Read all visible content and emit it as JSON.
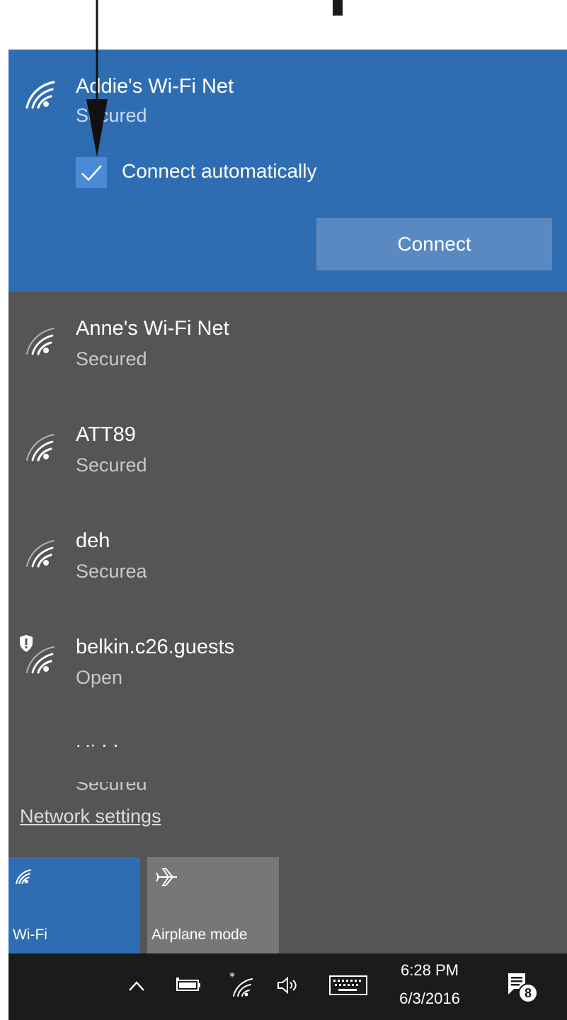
{
  "selected_network": {
    "name": "Addie's Wi-Fi Net",
    "status": "Secured",
    "connect_auto_label": "Connect automatically",
    "connect_auto_checked": true,
    "connect_button": "Connect"
  },
  "networks": [
    {
      "name": "Anne's Wi-Fi Net",
      "status": "Secured",
      "icon": "wifi-icon"
    },
    {
      "name": "ATT89",
      "status": "Secured",
      "icon": "wifi-icon"
    },
    {
      "name": "deh",
      "status": "Securea",
      "icon": "wifi-icon"
    },
    {
      "name": "belkin.c26.guests",
      "status": "Open",
      "icon": "wifi-open-warning-icon"
    },
    {
      "name": "Hidden",
      "status": "Secured",
      "icon": "wifi-icon"
    }
  ],
  "network_settings_link": "Network settings",
  "quick_actions": [
    {
      "label": "Wi-Fi",
      "icon": "wifi-icon",
      "active": true
    },
    {
      "label": "Airplane mode",
      "icon": "airplane-icon",
      "active": false
    }
  ],
  "taskbar": {
    "time": "6:28 PM",
    "date": "6/3/2016",
    "notification_count": "8"
  },
  "colors": {
    "accent": "#2f6db3",
    "panel": "#555555",
    "taskbar": "#1b1b1b"
  }
}
